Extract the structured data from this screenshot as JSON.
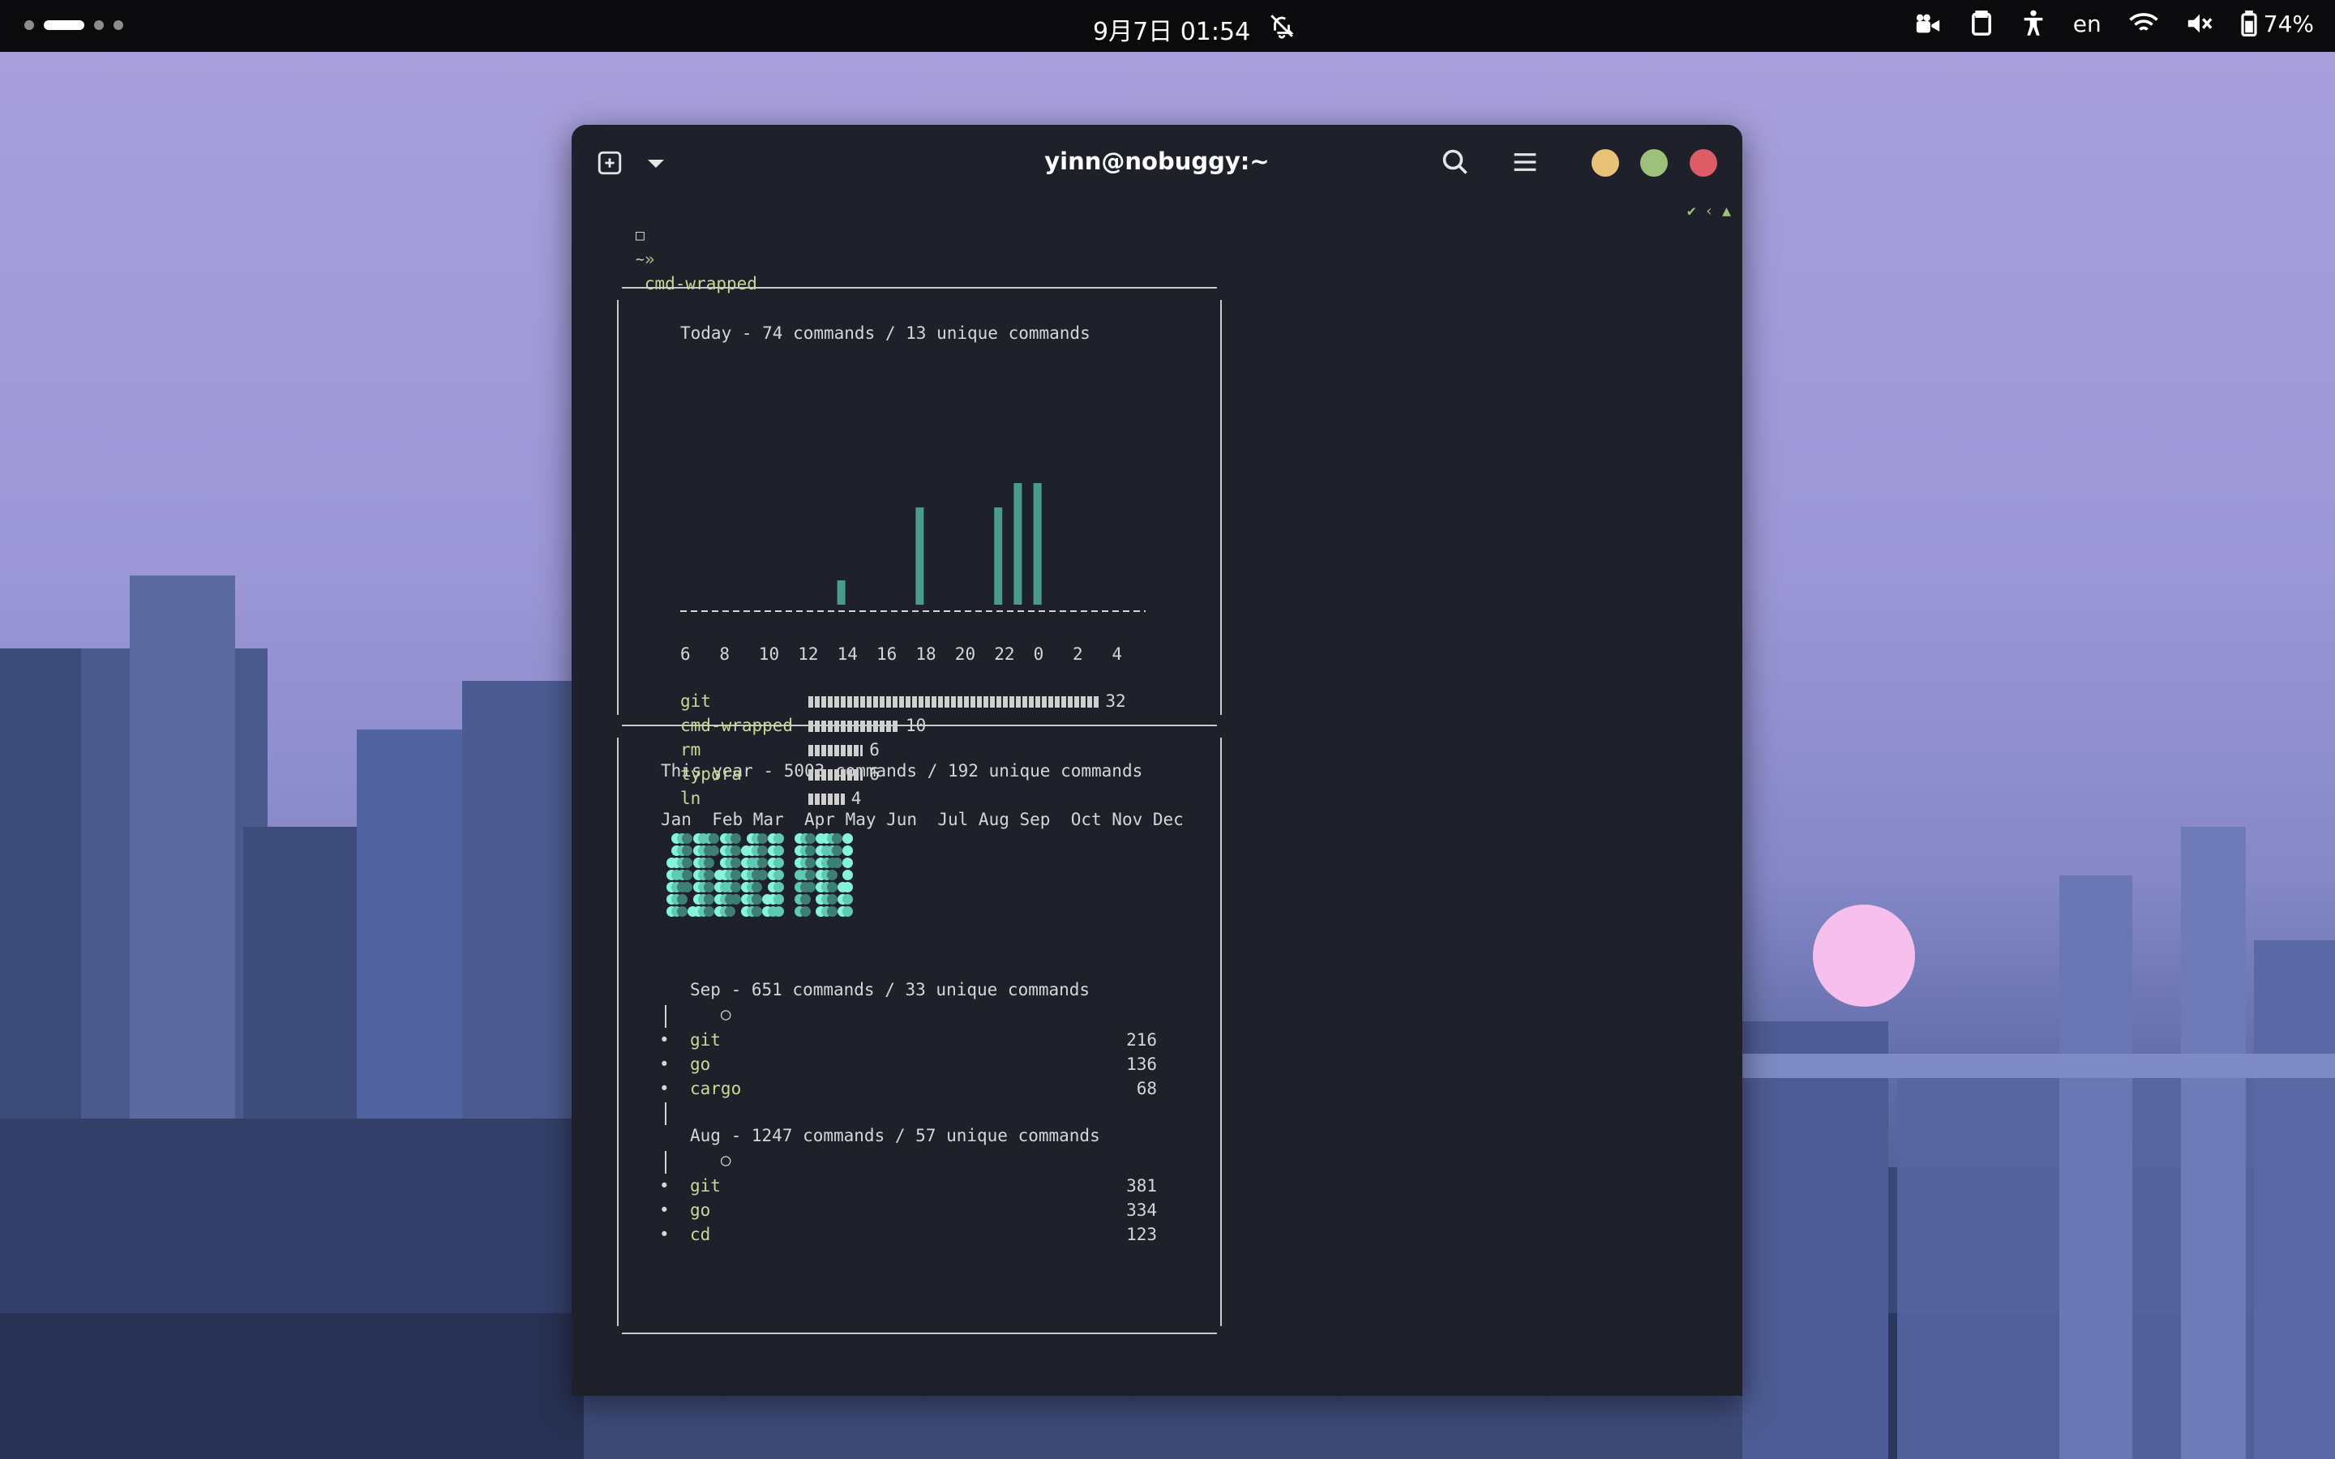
{
  "topbar": {
    "clock": "9月7日 01:54",
    "language": "en",
    "battery": "74%"
  },
  "window": {
    "title": "yinn@nobuggy:~",
    "buttons": {
      "minimize_color": "#e8c276",
      "maximize_color": "#9dc07d",
      "close_color": "#dd5c66"
    }
  },
  "prompt": {
    "cwd_icon": "□",
    "cwd": "~",
    "arrow": "»",
    "command": "cmd-wrapped",
    "right_status": "✔ ‹ ▲"
  },
  "today": {
    "header": "Today - 74 commands / 13 unique commands",
    "axis_line": "-------------------------------------------------------",
    "hour_labels": [
      "6",
      "8",
      "10",
      "12",
      "14",
      "16",
      "18",
      "20",
      "22",
      "0",
      "2",
      "4"
    ],
    "top_commands": [
      {
        "name": "git",
        "count": "32",
        "bar": 32
      },
      {
        "name": "cmd-wrapped",
        "count": "10",
        "bar": 10
      },
      {
        "name": "rm",
        "count": "6",
        "bar": 6
      },
      {
        "name": "typora",
        "count": "6",
        "bar": 6
      },
      {
        "name": "ln",
        "count": "4",
        "bar": 4
      }
    ]
  },
  "chart_data": {
    "type": "bar",
    "title": "Today - 74 commands / 13 unique commands",
    "categories": [
      "6",
      "7",
      "8",
      "9",
      "10",
      "11",
      "12",
      "13",
      "14",
      "15",
      "16",
      "17",
      "18",
      "19",
      "20",
      "21",
      "22",
      "23",
      "0",
      "1",
      "2",
      "3",
      "4",
      "5"
    ],
    "values": [
      0,
      0,
      0,
      0,
      0,
      0,
      0,
      0,
      4,
      0,
      0,
      0,
      16,
      0,
      0,
      0,
      16,
      20,
      20,
      0,
      0,
      0,
      0,
      0
    ],
    "xlabel": "",
    "ylabel": ""
  },
  "year": {
    "header": "This year - 5003 commands / 192 unique commands",
    "months": "Jan  Feb Mar  Apr May Jun  Jul Aug Sep  Oct Nov Dec",
    "heatmap_colors": [
      "#1e2129",
      "#3f7e73",
      "#5fc9b6",
      "#86f3dc"
    ],
    "sep": {
      "header": "Sep - 651 commands / 33 unique commands",
      "items": [
        {
          "name": "git",
          "count": "216"
        },
        {
          "name": "go",
          "count": "136"
        },
        {
          "name": "cargo",
          "count": "68"
        }
      ]
    },
    "aug": {
      "header": "Aug - 1247 commands / 57 unique commands",
      "items": [
        {
          "name": "git",
          "count": "381"
        },
        {
          "name": "go",
          "count": "334"
        },
        {
          "name": "cd",
          "count": "123"
        }
      ]
    },
    "timeline_marker": "○",
    "bullet": "•"
  }
}
